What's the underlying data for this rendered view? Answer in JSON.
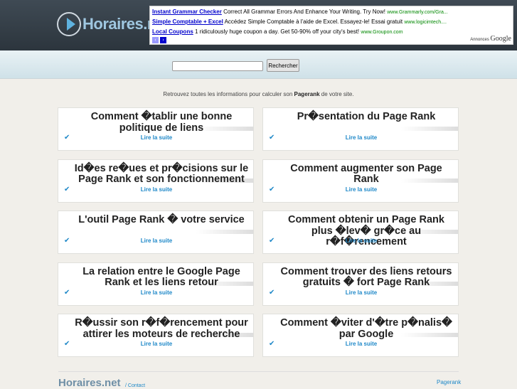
{
  "header": {
    "logo": "Horaires",
    "logo_suffix": ".net"
  },
  "ads": {
    "items": [
      {
        "title": "Instant Grammar Checker",
        "text": "Correct All Grammar Errors And Enhance Your Writing. Try Now!",
        "url": "www.Grammarly.com/Gra..."
      },
      {
        "title": "Simple Comptable + Excel",
        "text": "Accédez Simple Comptable à l'aide de Excel. Essayez-le! Essai gratuit",
        "url": "www.logicimtech...."
      },
      {
        "title": "Local Coupons",
        "text": "1 ridiculously huge coupon a day. Get 50-90% off your city's best!",
        "url": "www.Groupon.com"
      }
    ],
    "label": "Annonces",
    "brand": "Google"
  },
  "search": {
    "button": "Rechercher",
    "value": ""
  },
  "intro": {
    "before": "Retrouvez toutes les informations pour calculer son",
    "bold": "Pagerank",
    "after": "de votre site."
  },
  "cards": [
    {
      "title": "Comment �tablir une bonne politique de liens",
      "link": "Lire la suite"
    },
    {
      "title": "Pr�sentation du Page Rank",
      "link": "Lire la suite"
    },
    {
      "title": "Id�es re�ues et pr�cisions sur le Page Rank et son fonctionnement",
      "link": "Lire la suite"
    },
    {
      "title": "Comment augmenter son Page Rank",
      "link": "Lire la suite"
    },
    {
      "title": "L'outil Page Rank � votre service",
      "link": "Lire la suite"
    },
    {
      "title": "Comment obtenir un Page Rank plus �lev� gr�ce au r�f�rencement",
      "link": "Lire la suite"
    },
    {
      "title": "La relation entre le Google Page Rank et les liens retour",
      "link": "Lire la suite"
    },
    {
      "title": "Comment trouver des liens retours gratuits � fort Page Rank",
      "link": "Lire la suite"
    },
    {
      "title": "R�ussir son r�f�rencement pour attirer les moteurs de recherche",
      "link": "Lire la suite"
    },
    {
      "title": "Comment �viter d'�tre p�nalis� par Google",
      "link": "Lire la suite"
    }
  ],
  "footer": {
    "logo": "Horaires.net",
    "contact": "/ Contact",
    "pagerank": "Pagerank"
  }
}
